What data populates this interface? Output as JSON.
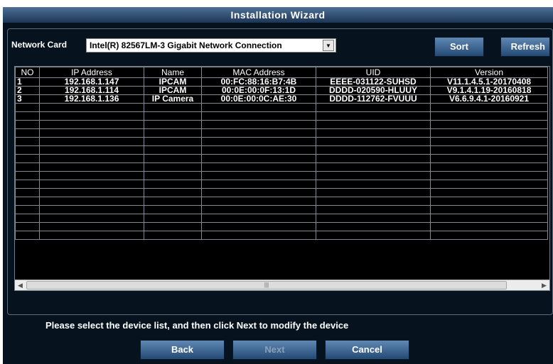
{
  "window": {
    "title": "Installation Wizard"
  },
  "network_card": {
    "label": "Network Card",
    "selected": "Intel(R) 82567LM-3 Gigabit Network Connection"
  },
  "toolbar": {
    "sort_label": "Sort",
    "refresh_label": "Refresh"
  },
  "grid": {
    "columns": [
      "NO",
      "IP Address",
      "Name",
      "MAC Address",
      "UID",
      "Version"
    ],
    "rows": [
      [
        "1",
        "192.168.1.147",
        "IPCAM",
        "00:FC:88:16:B7:4B",
        "EEEE-031122-SUHSD",
        "V11.1.4.5.1-20170408"
      ],
      [
        "2",
        "192.168.1.114",
        "IPCAM",
        "00:0E:00:0F:13:1D",
        "DDDD-020590-HLUUY",
        "V9.1.4.1.19-20160818"
      ],
      [
        "3",
        "192.168.1.136",
        "IP Camera",
        "00:0E:00:0C:AE:30",
        "DDDD-112762-FVUUU",
        "V6.6.9.4.1-20160921"
      ]
    ],
    "empty_row_count": 16
  },
  "hint": "Please select the device list, and then click Next to modify the device",
  "footer": {
    "back_label": "Back",
    "next_label": "Next",
    "cancel_label": "Cancel"
  },
  "colors": {
    "background": "#06131f",
    "title_bar": "#2f4d70",
    "button": "#3f6791",
    "grid_line": "#7f8a95"
  }
}
